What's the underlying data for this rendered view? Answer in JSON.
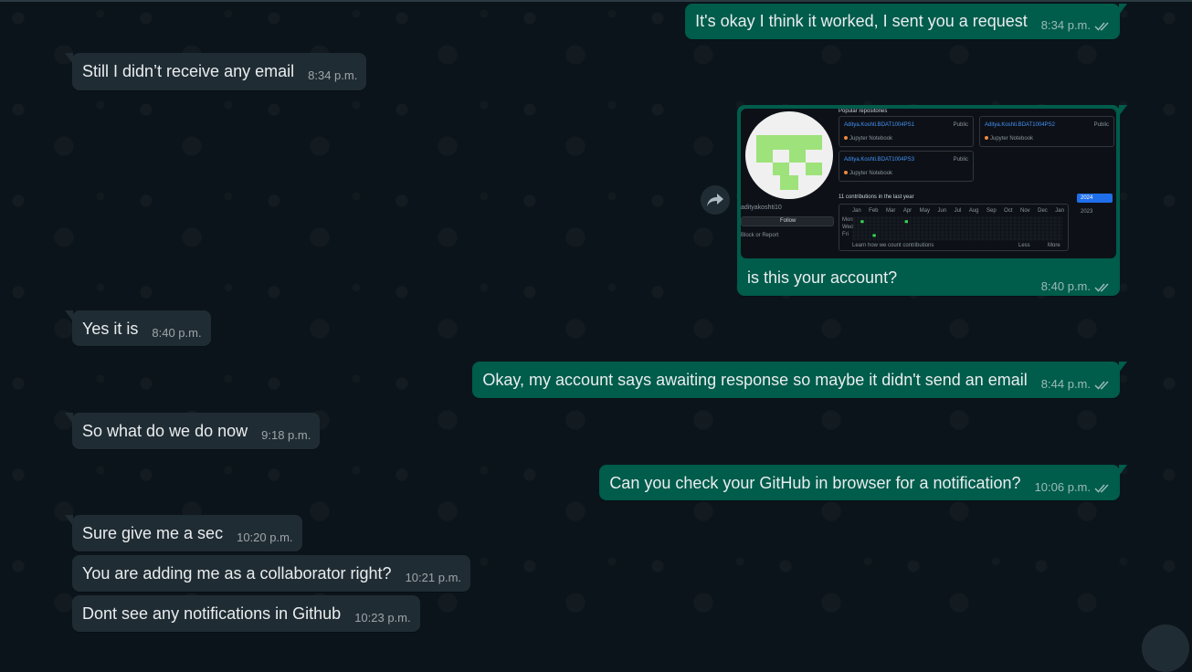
{
  "messages": [
    {
      "id": "m1",
      "dir": "out",
      "text": "It's okay I think it worked, I sent you a request",
      "time": "8:34 p.m."
    },
    {
      "id": "m2",
      "dir": "in",
      "text": "Still I didn’t receive any email",
      "time": "8:34 p.m."
    },
    {
      "id": "m3",
      "dir": "out",
      "type": "image",
      "caption": "is this your account?",
      "time": "8:40 p.m."
    },
    {
      "id": "m4",
      "dir": "in",
      "text": "Yes it is",
      "time": "8:40 p.m."
    },
    {
      "id": "m5",
      "dir": "out",
      "text": "Okay, my account says awaiting response so maybe it didn't send an email",
      "time": "8:44 p.m."
    },
    {
      "id": "m6",
      "dir": "in",
      "text": "So what do we do now",
      "time": "9:18 p.m."
    },
    {
      "id": "m7",
      "dir": "out",
      "text": "Can you check your GitHub in browser for a notification?",
      "time": "10:06 p.m."
    },
    {
      "id": "m8",
      "dir": "in",
      "text": "Sure give me a sec",
      "time": "10:20 p.m."
    },
    {
      "id": "m9",
      "dir": "in",
      "text": "You are adding me as a collaborator right?",
      "time": "10:21 p.m."
    },
    {
      "id": "m10",
      "dir": "in",
      "text": "Dont see any notifications in Github",
      "time": "10:23 p.m."
    }
  ],
  "screenshot": {
    "popular_label": "Popular repositories",
    "username": "adityakoshti10",
    "follow_label": "Follow",
    "block_label": "Block or Report",
    "repos": [
      {
        "name": "Aditya.Koshti.BDAT1004PS1",
        "visibility": "Public",
        "lang": "Jupyter Notebook"
      },
      {
        "name": "Aditya.Koshti.BDAT1004PS2",
        "visibility": "Public",
        "lang": "Jupyter Notebook"
      },
      {
        "name": "Aditya.Koshti.BDAT1004PS3",
        "visibility": "Public",
        "lang": "Jupyter Notebook"
      }
    ],
    "contributions_label": "11 contributions in the last year",
    "months": [
      "Jan",
      "Feb",
      "Mar",
      "Apr",
      "May",
      "Jun",
      "Jul",
      "Aug",
      "Sep",
      "Oct",
      "Nov",
      "Dec",
      "Jan"
    ],
    "days": [
      "Mon",
      "Wed",
      "Fri"
    ],
    "learn_label": "Learn how we count contributions",
    "less_label": "Less",
    "more_label": "More",
    "year_selected": "2024",
    "year_other": "2023"
  },
  "colors": {
    "incoming": "#202c33",
    "outgoing": "#005c4b",
    "background": "#0b141a",
    "read_tick": "#53bdeb"
  }
}
